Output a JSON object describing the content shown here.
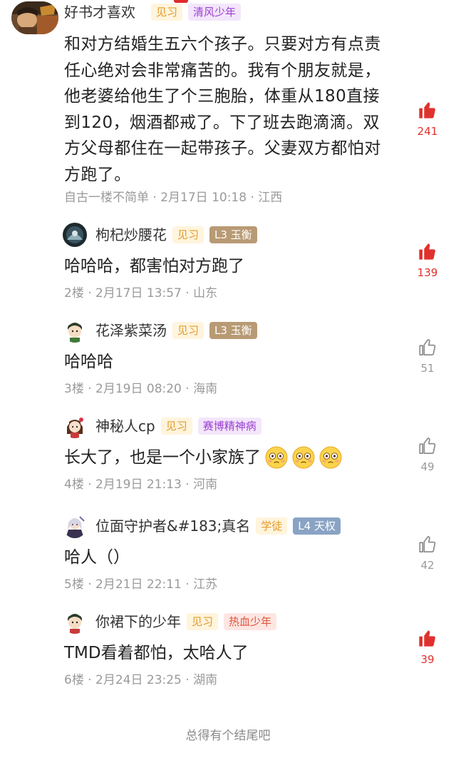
{
  "op": {
    "username": "好书才喜欢",
    "badges": [
      "见习",
      "清风少年"
    ],
    "text": "和对方结婚生五六个孩子。只要对方有点责任心绝对会非常痛苦的。我有个朋友就是，他老婆给他生了个三胞胎，体重从180直接到120，烟酒都戒了。下了班去跑滴滴。双方父母都住在一起带孩子。父妻双方都怕对方跑了。",
    "meta": "自古一楼不简单 · 2月17日 10:18 · 江西",
    "likes": "241",
    "liked": true
  },
  "replies": [
    {
      "username": "枸杞炒腰花",
      "badges": [
        "见习",
        "L3 玉衡"
      ],
      "text": "哈哈哈，都害怕对方跑了",
      "meta": "2楼 · 2月17日 13:57 · 山东",
      "likes": "139",
      "liked": true
    },
    {
      "username": "花泽紫菜汤",
      "badges": [
        "见习",
        "L3 玉衡"
      ],
      "text": "哈哈哈",
      "meta": "3楼 · 2月19日 08:20 · 海南",
      "likes": "51",
      "liked": false
    },
    {
      "username": "神秘人cp",
      "badges": [
        "见习",
        "赛博精神病"
      ],
      "text": "长大了，也是一个小家族了",
      "emoji": "flushed-face",
      "meta": "4楼 · 2月19日 21:13 · 河南",
      "likes": "49",
      "liked": false
    },
    {
      "username": "位面守护者&#183;真名",
      "badges": [
        "学徒",
        "L4 天权"
      ],
      "text": "哈人（）",
      "meta": "5楼 · 2月21日 22:11 · 江苏",
      "likes": "42",
      "liked": false
    },
    {
      "username": "你裙下的少年",
      "badges": [
        "见习",
        "热血少年"
      ],
      "text": "TMD看着都怕，太哈人了",
      "meta": "6楼 · 2月24日 23:25 · 湖南",
      "likes": "39",
      "liked": true
    }
  ],
  "footer": "总得有个结尾吧",
  "colors": {
    "like_red": "#e0312d",
    "meta_gray": "#9a9a9a",
    "badge_jianxi": "#e39a2a",
    "badge_purple": "#9b3fd1"
  }
}
